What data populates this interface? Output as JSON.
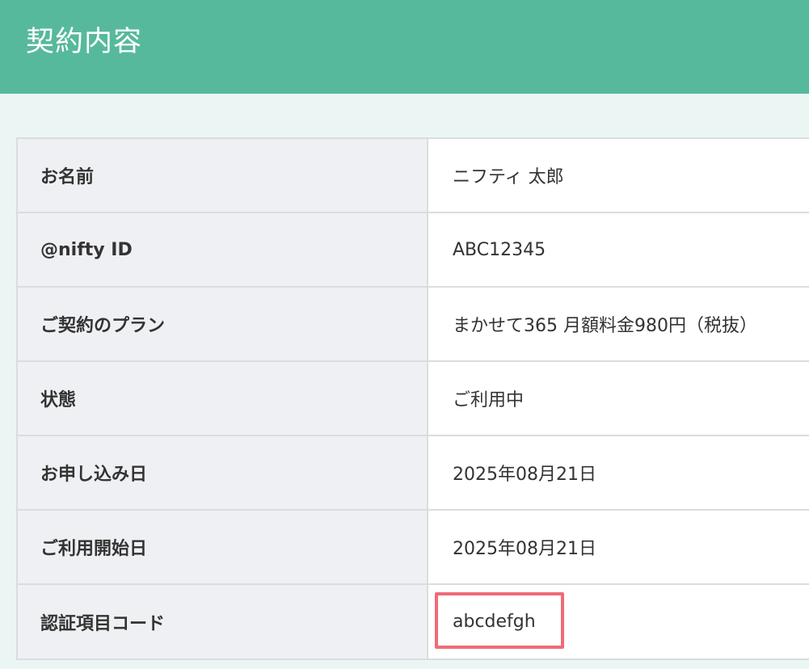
{
  "header": {
    "title": "契約内容"
  },
  "contract": {
    "rows": [
      {
        "label": "お名前",
        "value": "ニフティ 太郎"
      },
      {
        "label": "@nifty ID",
        "value": "ABC12345"
      },
      {
        "label": "ご契約のプラン",
        "value": "まかせて365 月額料金980円（税抜）"
      },
      {
        "label": "状態",
        "value": "ご利用中"
      },
      {
        "label": "お申し込み日",
        "value": "2025年08月21日"
      },
      {
        "label": "ご利用開始日",
        "value": "2025年08月21日"
      },
      {
        "label": "認証項目コード",
        "value": "abcdefgh"
      }
    ]
  },
  "colors": {
    "header_bg": "#57b99c",
    "page_bg": "#ebf6f4",
    "label_bg": "#eff0f3",
    "highlight": "#ef6b77"
  }
}
